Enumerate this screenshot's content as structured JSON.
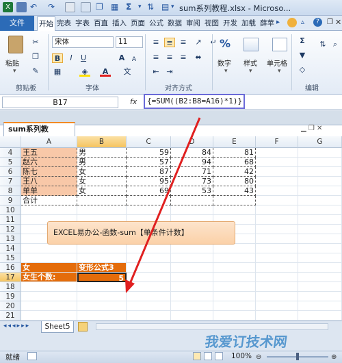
{
  "window": {
    "title": "sum系列教程.xlsx - Microso..."
  },
  "ribbon_tabs": {
    "file": "文件",
    "tabs": [
      "开始",
      "完表",
      "字表",
      "百直",
      "插入",
      "页面",
      "公式",
      "数据",
      "审阅",
      "视图",
      "开发",
      "加载",
      "薛苹"
    ],
    "active": "开始"
  },
  "ribbon": {
    "paste": "粘贴",
    "clipboard_label": "剪贴板",
    "font_name": "宋体",
    "font_size": "11",
    "font_label": "字体",
    "align_label": "对齐方式",
    "number_label": "数字",
    "style_label": "样式",
    "cells_label": "单元格",
    "edit_label": "编辑",
    "bold": "B",
    "italic": "I",
    "underline": "U",
    "percent": "%"
  },
  "formula_bar": {
    "name_box": "B17",
    "fx": "fx",
    "formula": "{=SUM((B2:B8=A16)*1)}"
  },
  "workbook_tab": "sum系列教程.xlsx",
  "grid": {
    "columns": [
      "A",
      "B",
      "C",
      "D",
      "E",
      "F",
      "G"
    ],
    "selected_column": "B",
    "rows": [
      {
        "num": "4",
        "a": "王五",
        "b": "男",
        "c": "59",
        "d": "84",
        "e": "81"
      },
      {
        "num": "5",
        "a": "赵六",
        "b": "男",
        "c": "57",
        "d": "94",
        "e": "68"
      },
      {
        "num": "6",
        "a": "陈七",
        "b": "女",
        "c": "87",
        "d": "71",
        "e": "42"
      },
      {
        "num": "7",
        "a": "王八",
        "b": "女",
        "c": "95",
        "d": "73",
        "e": "80"
      },
      {
        "num": "8",
        "a": "单单",
        "b": "女",
        "c": "69",
        "d": "53",
        "e": "43"
      },
      {
        "num": "9",
        "a": "合计",
        "b": "",
        "c": "",
        "d": "",
        "e": ""
      },
      {
        "num": "10"
      },
      {
        "num": "11"
      },
      {
        "num": "12"
      },
      {
        "num": "13"
      },
      {
        "num": "14"
      },
      {
        "num": "15"
      },
      {
        "num": "16",
        "a": "女",
        "b": "变形公式3"
      },
      {
        "num": "17",
        "a": "女生个数:",
        "b": "5"
      },
      {
        "num": "18"
      },
      {
        "num": "19"
      },
      {
        "num": "20"
      },
      {
        "num": "21"
      }
    ],
    "selected_row": "17"
  },
  "callout": "EXCEL易办公-函数-sum【单条件计数】",
  "sheet_tab": "Sheet5",
  "status": {
    "ready": "就绪",
    "zoom": "100%"
  },
  "watermark": "我爱订技术网",
  "colors": {
    "accent": "#2c6bb7",
    "selected_cell": "#e46c0a",
    "peach": "#f8c8a8",
    "arrow": "#e02020"
  }
}
